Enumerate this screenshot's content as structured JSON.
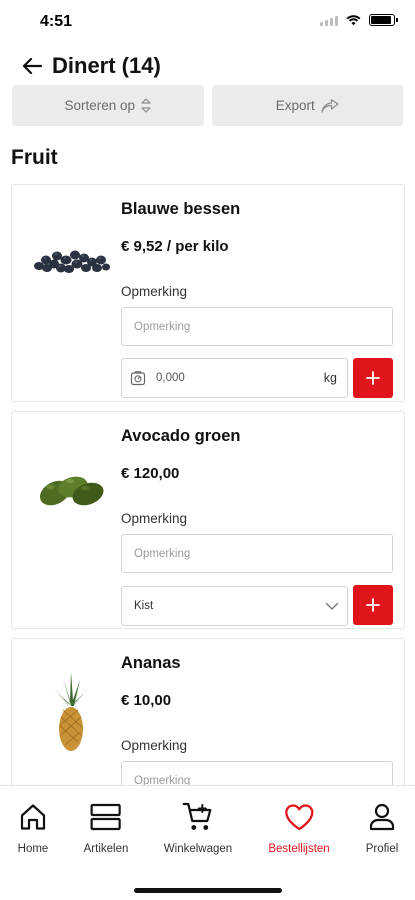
{
  "status_bar": {
    "time": "4:51"
  },
  "header": {
    "title": "Dinert (14)"
  },
  "toolbar": {
    "sort_label": "Sorteren op",
    "export_label": "Export"
  },
  "section": {
    "title": "Fruit"
  },
  "products": [
    {
      "name": "Blauwe bessen",
      "price": "€ 9,52 / per kilo",
      "note_label": "Opmerking",
      "note_placeholder": "Opmerking",
      "quantity": "0,000",
      "unit": "kg",
      "image_icon": "blueberries-image"
    },
    {
      "name": "Avocado groen",
      "price": "€ 120,00",
      "note_label": "Opmerking",
      "note_placeholder": "Opmerking",
      "select_value": "Kist",
      "image_icon": "avocado-image"
    },
    {
      "name": "Ananas",
      "price": "€ 10,00",
      "note_label": "Opmerking",
      "note_placeholder": "Opmerking",
      "image_icon": "pineapple-image"
    }
  ],
  "bottom_nav": {
    "items": [
      {
        "label": "Home",
        "icon": "home-icon"
      },
      {
        "label": "Artikelen",
        "icon": "articles-icon"
      },
      {
        "label": "Winkelwagen",
        "icon": "cart-icon"
      },
      {
        "label": "Bestellijsten",
        "icon": "heart-icon",
        "active": true
      },
      {
        "label": "Profiel",
        "icon": "profile-icon"
      }
    ]
  },
  "colors": {
    "accent": "#e0151c",
    "button_bg": "#e9ebed",
    "border": "#d4d4d4"
  }
}
